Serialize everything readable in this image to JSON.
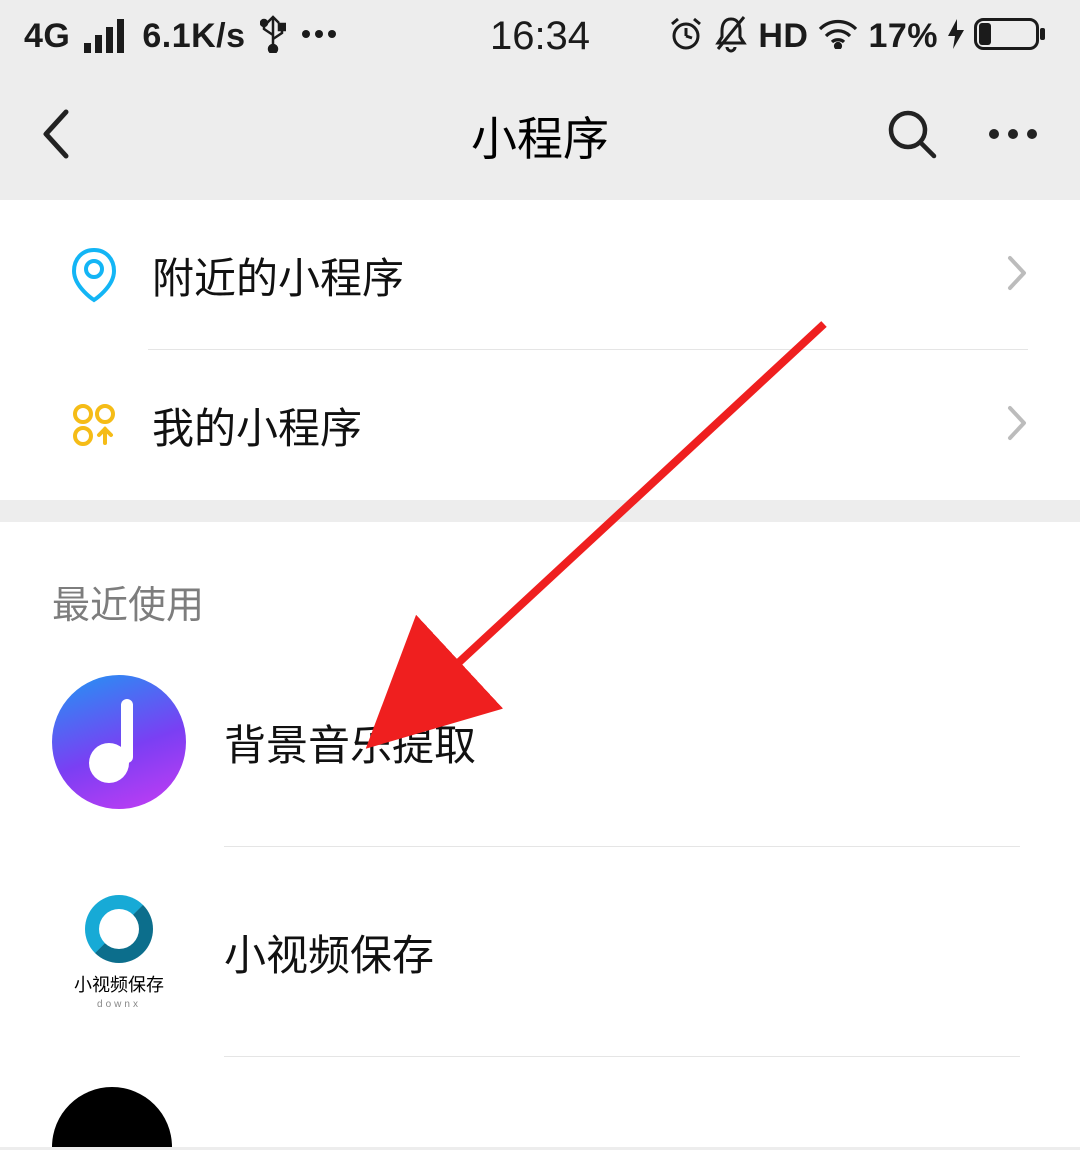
{
  "status_bar": {
    "network": "4G",
    "speed": "6.1K/s",
    "time": "16:34",
    "hd": "HD",
    "battery_pct": "17%"
  },
  "nav": {
    "title": "小程序"
  },
  "menu": {
    "nearby": "附近的小程序",
    "mine": "我的小程序"
  },
  "recent": {
    "header": "最近使用",
    "items": [
      {
        "label": "背景音乐提取"
      },
      {
        "label": "小视频保存",
        "icon_caption": "小视频保存",
        "icon_sub": "downx"
      },
      {
        "label": ""
      }
    ]
  }
}
